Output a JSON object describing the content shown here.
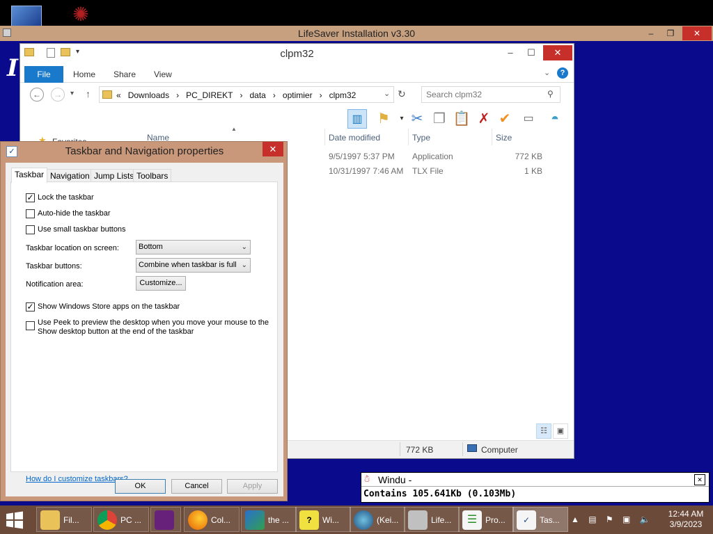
{
  "installer": {
    "title": "LifeSaver Installation v3.30",
    "minimize": "–",
    "maximize": "❐",
    "close": "✕"
  },
  "explorer": {
    "title": "clpm32",
    "minimize": "–",
    "maximize": "☐",
    "close": "✕",
    "tabs": [
      "File",
      "Home",
      "Share",
      "View"
    ],
    "breadcrumb": [
      "«",
      "Downloads",
      "›",
      "PC_DIREKT",
      "›",
      "data",
      "›",
      "optimier",
      "›",
      "clpm32"
    ],
    "search_placeholder": "Search clpm32",
    "columns": [
      "Name",
      "Date modified",
      "Type",
      "Size"
    ],
    "nav_item_partial": "Favorites",
    "files": [
      {
        "date": "9/5/1997 5:37 PM",
        "type": "Application",
        "size": "772 KB"
      },
      {
        "date": "10/31/1997 7:46 AM",
        "type": "TLX File",
        "size": "1 KB"
      }
    ],
    "status_size": "772 KB",
    "status_location": "Computer"
  },
  "dialog": {
    "title": "Taskbar and Navigation properties",
    "close": "✕",
    "tabs": [
      "Taskbar",
      "Navigation",
      "Jump Lists",
      "Toolbars"
    ],
    "checkboxes": [
      {
        "label": "Lock the taskbar",
        "mark": "✓"
      },
      {
        "label": "Auto-hide the taskbar",
        "mark": ""
      },
      {
        "label": "Use small taskbar buttons",
        "mark": ""
      },
      {
        "label": "Show Windows Store apps on the taskbar",
        "mark": "✓"
      },
      {
        "label": "Use Peek to preview the desktop when you move your mouse to the Show desktop button at the end of the taskbar",
        "mark": ""
      }
    ],
    "location_label": "Taskbar location on screen:",
    "location_value": "Bottom",
    "buttons_label": "Taskbar buttons:",
    "buttons_value": "Combine when taskbar is full",
    "notification_label": "Notification area:",
    "customize_label": "Customize...",
    "help_link": "How do I customize taskbars?",
    "ok": "OK",
    "cancel": "Cancel",
    "apply": "Apply"
  },
  "windu": {
    "title": "Windu -",
    "close": "✕",
    "text": "Contains 105.641Kb (0.103Mb)"
  },
  "taskbar": {
    "items": [
      "Fil...",
      "PC ...",
      "",
      "Col...",
      "the ...",
      "Wi...",
      "(Kei...",
      "Life...",
      "Pro...",
      "Tas..."
    ],
    "tray_icons": "▲ ▤ ⚑ ▣ 🔈",
    "time": "12:44 AM",
    "date": "3/9/2023"
  }
}
